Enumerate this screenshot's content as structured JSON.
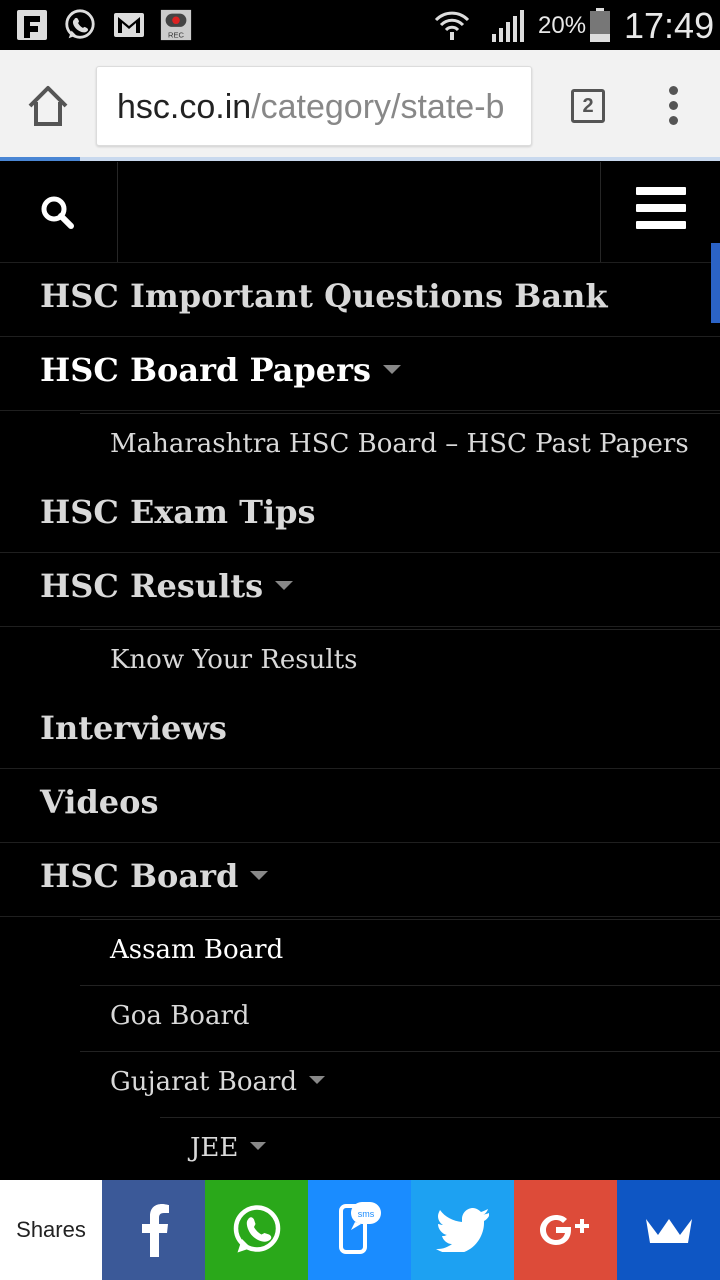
{
  "status_bar": {
    "battery_percent": "20%",
    "time": "17:49",
    "icons": [
      "flipboard-icon",
      "whatsapp-icon",
      "gmail-icon",
      "screen-recorder-icon",
      "wifi-icon",
      "signal-icon",
      "battery-icon"
    ],
    "recorder_label": "REC"
  },
  "browser": {
    "url_host": "hsc.co.in",
    "url_path": "/category/state-b",
    "tab_count": "2"
  },
  "nav": {
    "items": [
      {
        "label": "HSC Important Questions Bank"
      },
      {
        "label": "HSC Board Papers"
      },
      {
        "label": "Maharashtra HSC Board – HSC Past Papers"
      },
      {
        "label": "HSC Exam Tips"
      },
      {
        "label": "HSC Results"
      },
      {
        "label": "Know Your Results"
      },
      {
        "label": "Interviews"
      },
      {
        "label": "Videos"
      },
      {
        "label": "HSC Board"
      },
      {
        "label": "Assam Board"
      },
      {
        "label": "Goa Board"
      },
      {
        "label": "Gujarat Board"
      },
      {
        "label": "JEE"
      }
    ]
  },
  "share_bar": {
    "label": "Shares",
    "sms_label": "sms",
    "buttons": [
      {
        "name": "facebook",
        "color": "#3b5998"
      },
      {
        "name": "whatsapp",
        "color": "#2aa81a"
      },
      {
        "name": "sms",
        "color": "#1a8cff"
      },
      {
        "name": "twitter",
        "color": "#1da1f2"
      },
      {
        "name": "google-plus",
        "color": "#dd4b39"
      },
      {
        "name": "sumo",
        "color": "#0e56c4"
      }
    ]
  }
}
